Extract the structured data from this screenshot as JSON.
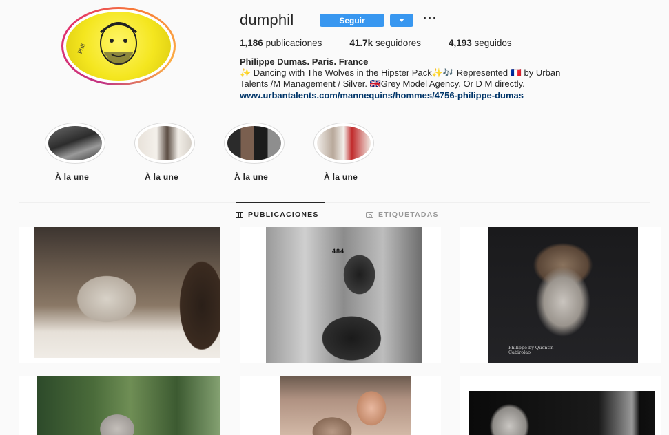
{
  "profile": {
    "username": "dumphil",
    "follow_label": "Seguir",
    "more_label": "···",
    "stats": {
      "posts_count": "1,186",
      "posts_label": "publicaciones",
      "followers_count": "41.7k",
      "followers_label": "seguidores",
      "following_count": "4,193",
      "following_label": "seguidos"
    },
    "full_name": "Philippe Dumas. Paris. France",
    "bio_line1": "✨ Dancing with The Wolves in the Hipster Pack✨🎶 Represented 🇫🇷 by Urban",
    "bio_line2": "Talents /M Management / Silver. 🇬🇧Grey Model Agency. Or D M directly.",
    "website": "www.urbantalents.com/mannequins/hommes/4756-philippe-dumas"
  },
  "highlights": [
    {
      "label": "À la une"
    },
    {
      "label": "À la une"
    },
    {
      "label": "À la une"
    },
    {
      "label": "À la une"
    }
  ],
  "tabs": {
    "posts": "PUBLICACIONES",
    "tagged": "ETIQUETADAS"
  },
  "posts": [
    {
      "caption": ""
    },
    {
      "caption": "484"
    },
    {
      "caption": "Philippe by Quentin Cabirolao"
    },
    {
      "caption": ""
    },
    {
      "caption": ""
    },
    {
      "caption": ""
    }
  ],
  "colors": {
    "accent": "#3897f0",
    "link": "#003569",
    "background": "#fafafa"
  }
}
